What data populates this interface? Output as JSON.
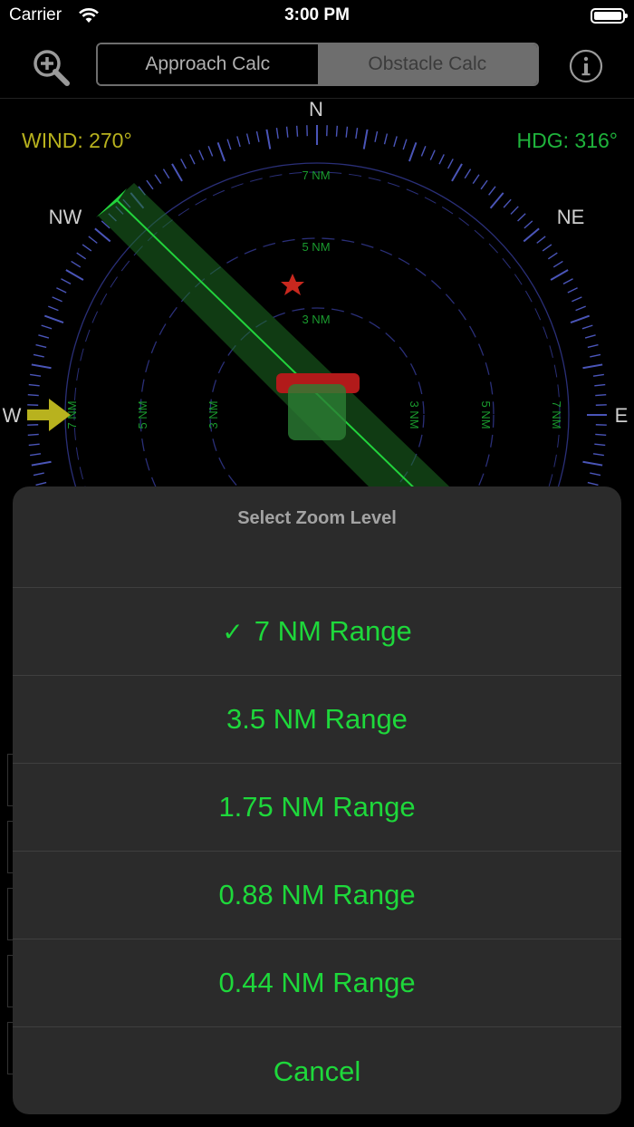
{
  "status_bar": {
    "carrier": "Carrier",
    "time": "3:00 PM"
  },
  "nav": {
    "segments": [
      {
        "label": "Approach Calc",
        "selected": false
      },
      {
        "label": "Obstacle Calc",
        "selected": true
      }
    ],
    "zoom_icon": "zoom-in-icon",
    "info_icon": "info-icon"
  },
  "compass": {
    "cardinals": {
      "n": "N",
      "ne": "NE",
      "nw": "NW",
      "e": "E",
      "w": "W"
    },
    "wind": "WIND: 270°",
    "hdg": "HDG: 316°",
    "range_labels": [
      "7 NM",
      "5 NM",
      "3 NM"
    ],
    "colors": {
      "ticks": "#4a55b8",
      "range": "#1a9a2e",
      "wind": "#b8b21e",
      "hdg": "#1fb43c",
      "obstacle": "#c8281e"
    }
  },
  "sheet": {
    "title": "Select Zoom Level",
    "check_mark": "✓",
    "options": [
      {
        "label": "7 NM Range",
        "checked": true
      },
      {
        "label": "3.5 NM Range",
        "checked": false
      },
      {
        "label": "1.75 NM Range",
        "checked": false
      },
      {
        "label": "0.88 NM Range",
        "checked": false
      },
      {
        "label": "0.44 NM Range",
        "checked": false
      }
    ],
    "cancel": "Cancel",
    "accent": "#1ed83b"
  }
}
